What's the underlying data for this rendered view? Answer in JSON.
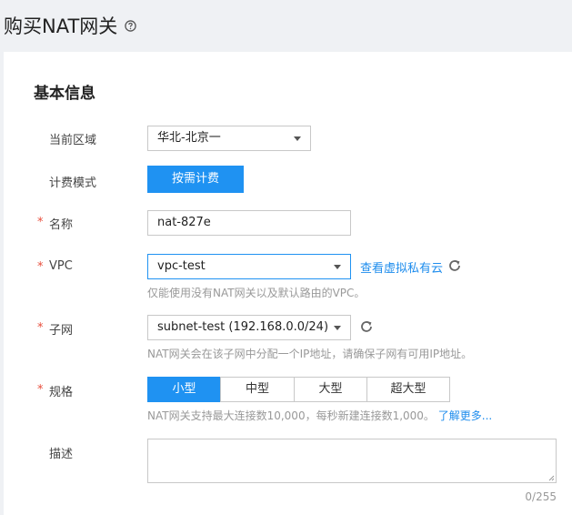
{
  "page": {
    "title": "购买NAT网关",
    "help_icon": "help-circle-icon"
  },
  "section": {
    "title": "基本信息"
  },
  "region": {
    "label": "当前区域",
    "value": "华北-北京一"
  },
  "billing": {
    "label": "计费模式",
    "button": "按需计费"
  },
  "name": {
    "required": "*",
    "label": "名称",
    "value": "nat-827e"
  },
  "vpc": {
    "required": "*",
    "label": "VPC",
    "value": "vpc-test",
    "link": "查看虚拟私有云",
    "hint": "仅能使用没有NAT网关以及默认路由的VPC。",
    "refresh_icon": "refresh-icon"
  },
  "subnet": {
    "required": "*",
    "label": "子网",
    "value": "subnet-test (192.168.0.0/24)",
    "hint": "NAT网关会在该子网中分配一个IP地址，请确保子网有可用IP地址。",
    "refresh_icon": "refresh-icon"
  },
  "spec": {
    "required": "*",
    "label": "规格",
    "options": [
      "小型",
      "中型",
      "大型",
      "超大型"
    ],
    "selected": "小型",
    "hint": "NAT网关支持最大连接数10,000，每秒新建连接数1,000。",
    "learn_more": "了解更多..."
  },
  "description": {
    "label": "描述",
    "value": "",
    "counter": "0/255"
  },
  "colors": {
    "accent": "#1f92f2",
    "required": "#e84e3c",
    "hint": "#999999",
    "link": "#1f8ded"
  }
}
